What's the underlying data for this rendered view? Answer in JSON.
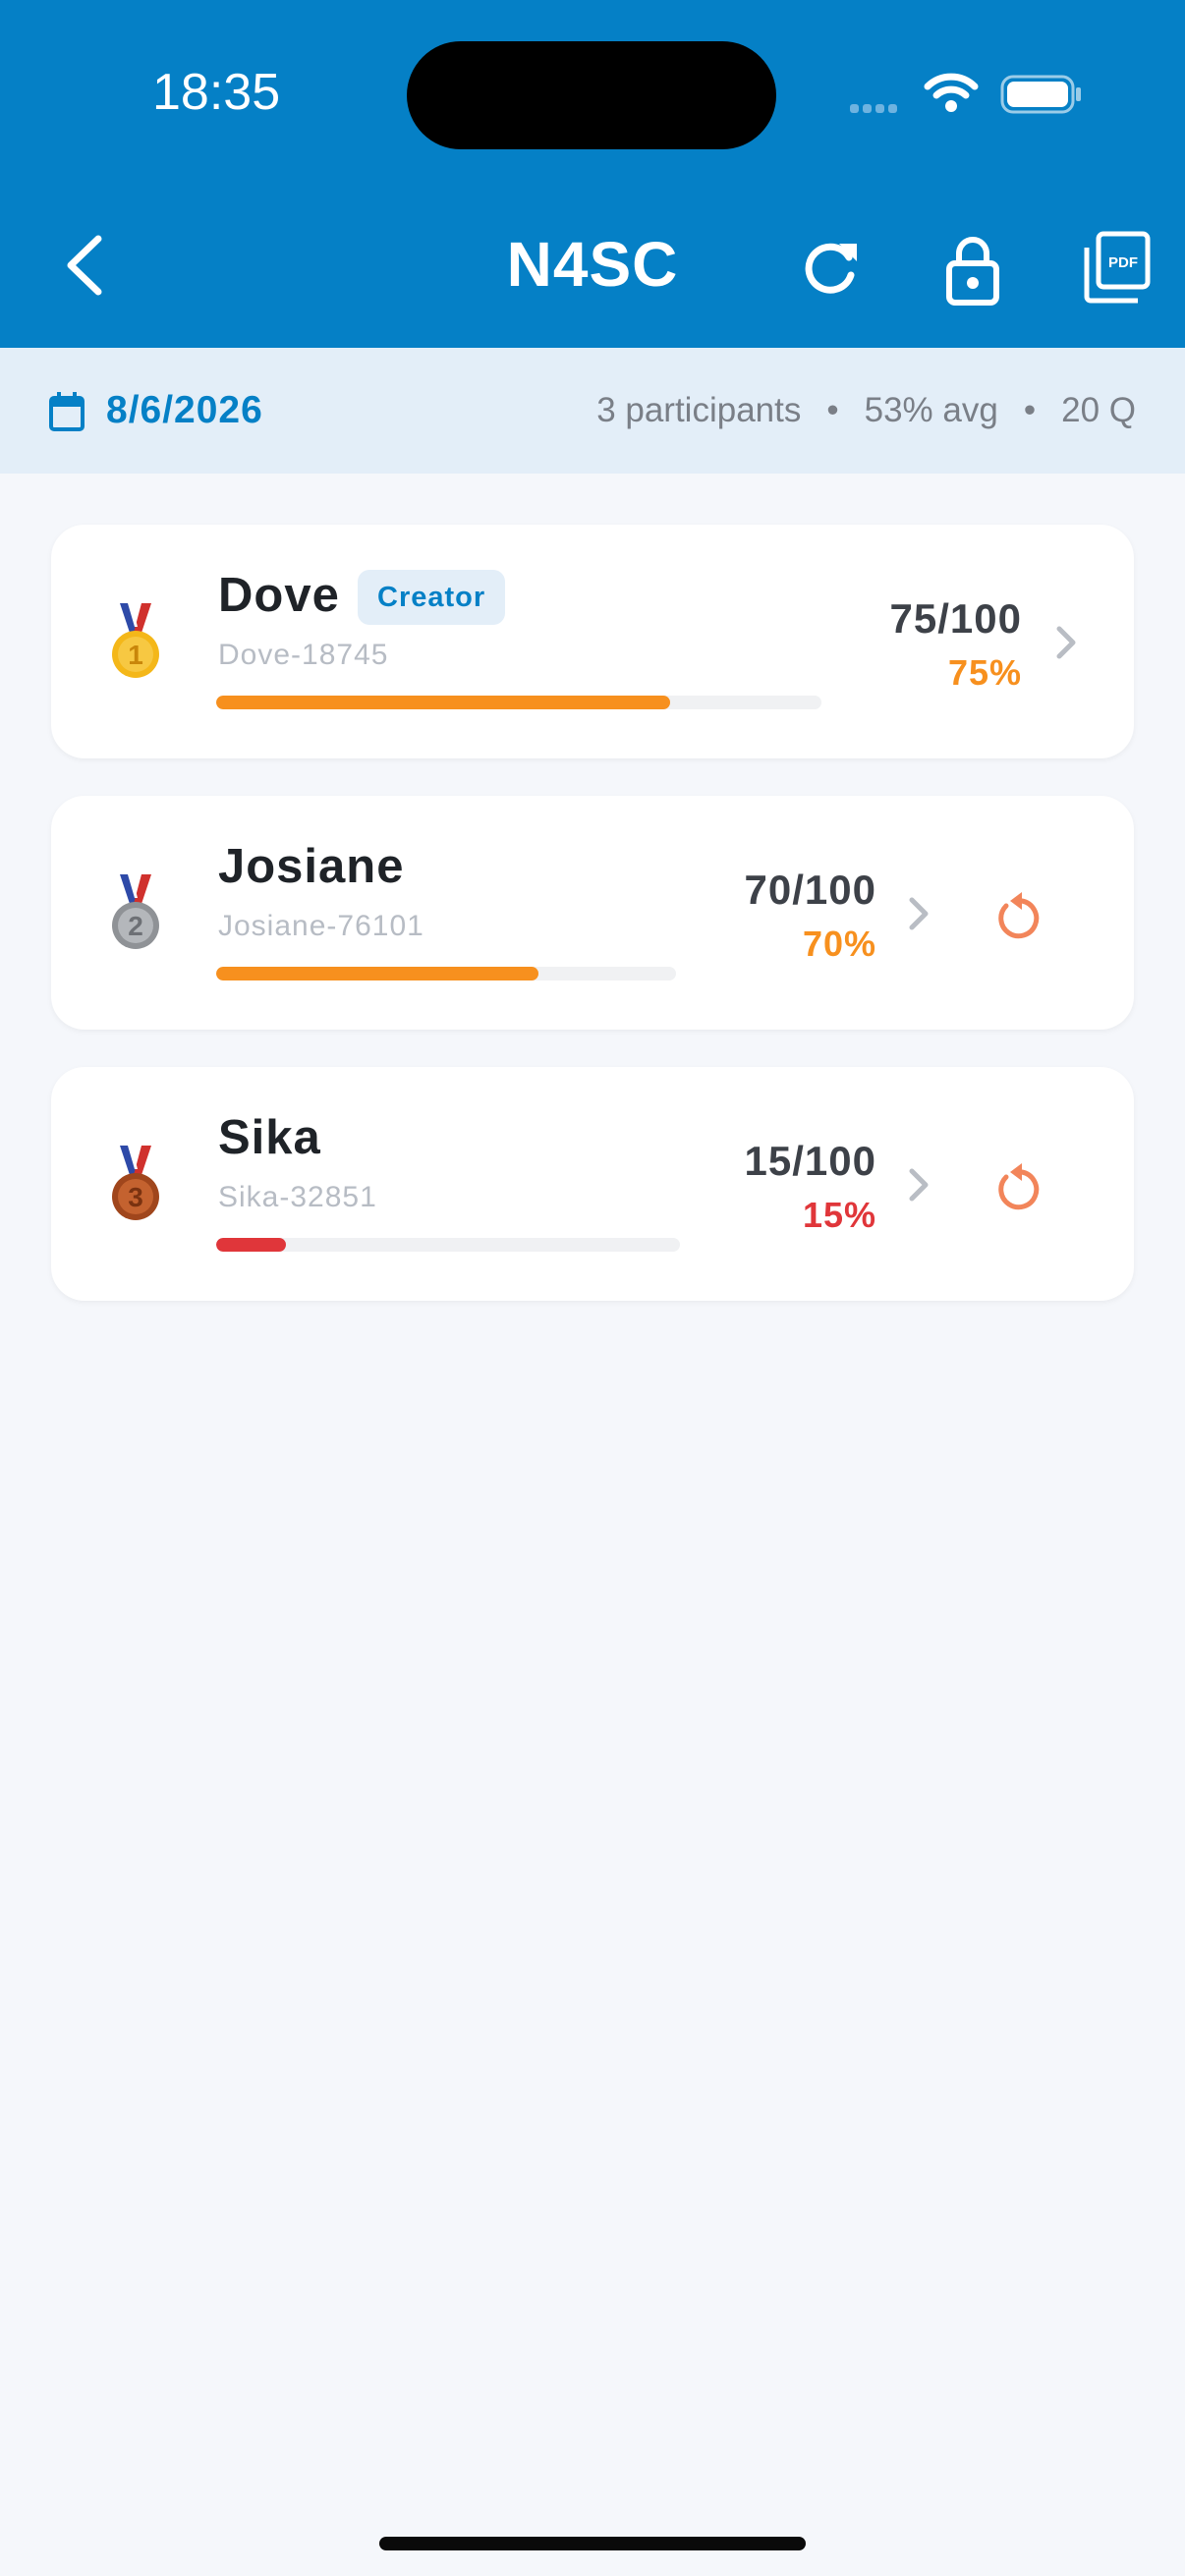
{
  "status_bar": {
    "time": "18:35"
  },
  "header": {
    "title": "N4SC",
    "back_icon": "chevron-left-icon",
    "actions": [
      "refresh-icon",
      "lock-icon",
      "pdf-icon"
    ]
  },
  "summary": {
    "date": "8/6/2026",
    "participants": "3 participants",
    "average": "53% avg",
    "questions": "20 Q",
    "separator": "•"
  },
  "participants": [
    {
      "rank": 1,
      "name": "Dove",
      "badge": "Creator",
      "id": "Dove-18745",
      "score": "75/100",
      "percent": "75%",
      "progress": 0.75,
      "color": "#f7901e",
      "medal": "gold-medal-icon",
      "has_retry": false
    },
    {
      "rank": 2,
      "name": "Josiane",
      "badge": "",
      "id": "Josiane-76101",
      "score": "70/100",
      "percent": "70%",
      "progress": 0.7,
      "color": "#f7901e",
      "medal": "silver-medal-icon",
      "has_retry": true
    },
    {
      "rank": 3,
      "name": "Sika",
      "badge": "",
      "id": "Sika-32851",
      "score": "15/100",
      "percent": "15%",
      "progress": 0.15,
      "color": "#e0363a",
      "medal": "bronze-medal-icon",
      "has_retry": true
    }
  ],
  "colors": {
    "header": "#0580c6",
    "accent": "#0580c6",
    "retry": "#f2855a"
  }
}
